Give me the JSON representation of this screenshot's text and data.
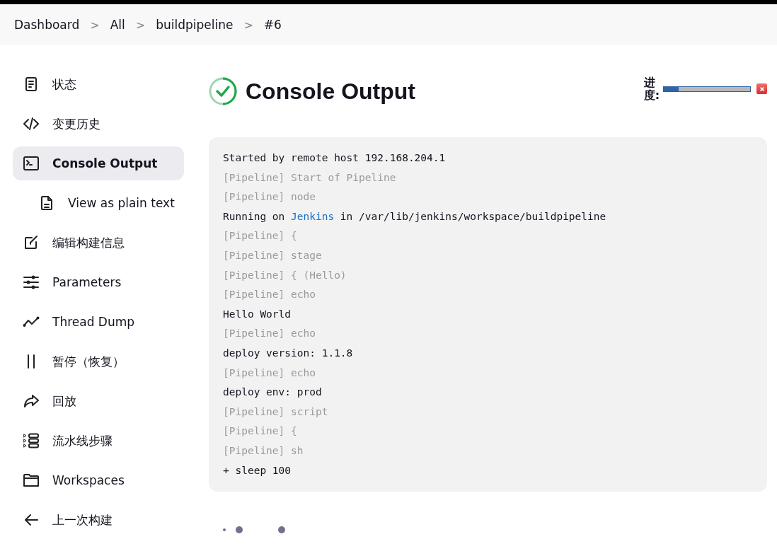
{
  "breadcrumbs": [
    {
      "label": "Dashboard"
    },
    {
      "label": "All"
    },
    {
      "label": "buildpipeline"
    },
    {
      "label": "#6"
    }
  ],
  "breadcrumb_separator": ">",
  "sidebar": {
    "items": [
      {
        "label": "状态",
        "kind": "document",
        "selected": false
      },
      {
        "label": "变更历史",
        "kind": "code",
        "selected": false
      },
      {
        "label": "Console Output",
        "kind": "terminal",
        "selected": true,
        "children": [
          {
            "label": "View as plain text",
            "kind": "file",
            "selected": false
          }
        ]
      },
      {
        "label": "编辑构建信息",
        "kind": "edit",
        "selected": false
      },
      {
        "label": "Parameters",
        "kind": "sliders",
        "selected": false
      },
      {
        "label": "Thread Dump",
        "kind": "graph",
        "selected": false
      },
      {
        "label": "暂停（恢复）",
        "kind": "pause",
        "selected": false
      },
      {
        "label": "回放",
        "kind": "redo",
        "selected": false
      },
      {
        "label": "流水线步骤",
        "kind": "steps",
        "selected": false
      },
      {
        "label": "Workspaces",
        "kind": "folder",
        "selected": false
      },
      {
        "label": "上一次构建",
        "kind": "back",
        "selected": false
      }
    ]
  },
  "header": {
    "title": "Console Output",
    "kind": "success",
    "progress": {
      "label": "进度:",
      "level": 0.17
    }
  },
  "console": {
    "lines": [
      {
        "kind": "output",
        "parts": [
          {
            "text": "Started by remote host 192.168.204.1",
            "kind": "plain"
          }
        ]
      },
      {
        "kind": "pipeline",
        "parts": [
          {
            "text": "[Pipeline] Start of Pipeline",
            "kind": "plain"
          }
        ]
      },
      {
        "kind": "pipeline",
        "parts": [
          {
            "text": "[Pipeline] node",
            "kind": "plain"
          }
        ]
      },
      {
        "kind": "output",
        "parts": [
          {
            "text": "Running on ",
            "kind": "plain"
          },
          {
            "text": "Jenkins",
            "kind": "link"
          },
          {
            "text": " in /var/lib/jenkins/workspace/buildpipeline",
            "kind": "plain"
          }
        ]
      },
      {
        "kind": "pipeline",
        "parts": [
          {
            "text": "[Pipeline] {",
            "kind": "plain"
          }
        ]
      },
      {
        "kind": "pipeline",
        "parts": [
          {
            "text": "[Pipeline] stage",
            "kind": "plain"
          }
        ]
      },
      {
        "kind": "pipeline",
        "parts": [
          {
            "text": "[Pipeline] { (Hello)",
            "kind": "plain"
          }
        ]
      },
      {
        "kind": "pipeline",
        "parts": [
          {
            "text": "[Pipeline] echo",
            "kind": "plain"
          }
        ]
      },
      {
        "kind": "output",
        "parts": [
          {
            "text": "Hello World",
            "kind": "plain"
          }
        ]
      },
      {
        "kind": "pipeline",
        "parts": [
          {
            "text": "[Pipeline] echo",
            "kind": "plain"
          }
        ]
      },
      {
        "kind": "output",
        "parts": [
          {
            "text": "deploy version: 1.1.8",
            "kind": "plain"
          }
        ]
      },
      {
        "kind": "pipeline",
        "parts": [
          {
            "text": "[Pipeline] echo",
            "kind": "plain"
          }
        ]
      },
      {
        "kind": "output",
        "parts": [
          {
            "text": "deploy env: prod",
            "kind": "plain"
          }
        ]
      },
      {
        "kind": "pipeline",
        "parts": [
          {
            "text": "[Pipeline] script",
            "kind": "plain"
          }
        ]
      },
      {
        "kind": "pipeline",
        "parts": [
          {
            "text": "[Pipeline] {",
            "kind": "plain"
          }
        ]
      },
      {
        "kind": "pipeline",
        "parts": [
          {
            "text": "[Pipeline] sh",
            "kind": "plain"
          }
        ]
      },
      {
        "kind": "output",
        "parts": [
          {
            "text": "+ sleep 100",
            "kind": "plain"
          }
        ]
      }
    ],
    "running": true
  }
}
